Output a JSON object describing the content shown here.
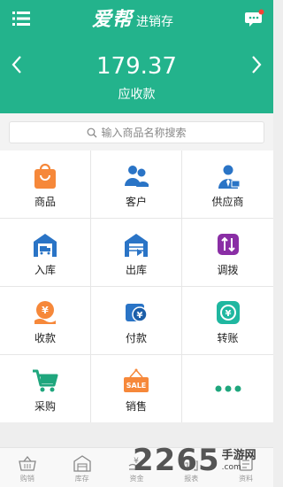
{
  "header": {
    "menu_icon": "menu-icon",
    "logo_main": "爱帮",
    "logo_sub": "进销存",
    "message_icon": "message-icon",
    "amount": "179.37",
    "amount_label": "应收款",
    "accent": "#23b38c"
  },
  "search": {
    "placeholder": "输入商品名称搜索"
  },
  "grid": {
    "items": [
      {
        "label": "商品",
        "icon": "shopping-bag-icon"
      },
      {
        "label": "客户",
        "icon": "customers-icon"
      },
      {
        "label": "供应商",
        "icon": "supplier-icon"
      },
      {
        "label": "入库",
        "icon": "inbound-icon"
      },
      {
        "label": "出库",
        "icon": "outbound-icon"
      },
      {
        "label": "调拨",
        "icon": "transfer-icon"
      },
      {
        "label": "收款",
        "icon": "receive-payment-icon"
      },
      {
        "label": "付款",
        "icon": "payment-icon"
      },
      {
        "label": "转账",
        "icon": "bank-transfer-icon"
      },
      {
        "label": "采购",
        "icon": "cart-icon"
      },
      {
        "label": "销售",
        "icon": "sale-sign-icon"
      },
      {
        "label": "",
        "icon": "more-icon"
      }
    ],
    "sale_sign_text": "SALE"
  },
  "bottom_nav": {
    "tabs": [
      {
        "label": "购销",
        "icon": "basket-icon"
      },
      {
        "label": "库存",
        "icon": "warehouse-icon"
      },
      {
        "label": "资金",
        "icon": "money-icon"
      },
      {
        "label": "报表",
        "icon": "report-icon"
      },
      {
        "label": "资料",
        "icon": "profile-icon"
      }
    ]
  },
  "watermark": {
    "number": "2265",
    "suffix": ".com",
    "site": "手游网"
  }
}
